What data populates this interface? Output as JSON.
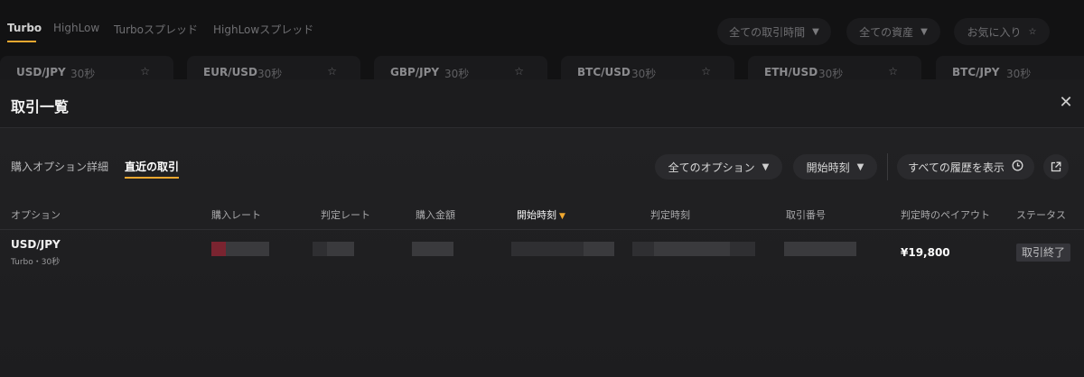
{
  "top_tabs": [
    "Turbo",
    "HighLow",
    "Turboスプレッド",
    "HighLowスプレッド"
  ],
  "top_filters": {
    "time": "全ての取引時間",
    "assets": "全ての資産",
    "favorites": "お気に入り"
  },
  "pairs": [
    {
      "name": "USD/JPY",
      "duration": "30秒"
    },
    {
      "name": "EUR/USD",
      "duration": "30秒"
    },
    {
      "name": "GBP/JPY",
      "duration": "30秒"
    },
    {
      "name": "BTC/USD",
      "duration": "30秒"
    },
    {
      "name": "ETH/USD",
      "duration": "30秒"
    },
    {
      "name": "BTC/JPY",
      "duration": "30秒"
    }
  ],
  "modal": {
    "title": "取引一覧",
    "tabs": [
      "購入オプション詳細",
      "直近の取引"
    ],
    "filters": {
      "options": "全てのオプション",
      "start_time": "開始時刻",
      "history": "すべての履歴を表示"
    },
    "columns": [
      "オプション",
      "購入レート",
      "判定レート",
      "購入金額",
      "開始時刻",
      "判定時刻",
      "取引番号",
      "判定時のペイアウト",
      "ステータス"
    ],
    "rows": [
      {
        "pair": "USD/JPY",
        "sub": "Turbo・30秒",
        "payout": "¥19,800",
        "status": "取引終了"
      }
    ]
  },
  "colors": {
    "accent": "#f0a830",
    "background": "#1f1f21"
  },
  "icons": [
    "star-icon",
    "chevron-down-icon",
    "close-icon",
    "clock-icon",
    "external-link-icon",
    "sort-caret-icon"
  ]
}
